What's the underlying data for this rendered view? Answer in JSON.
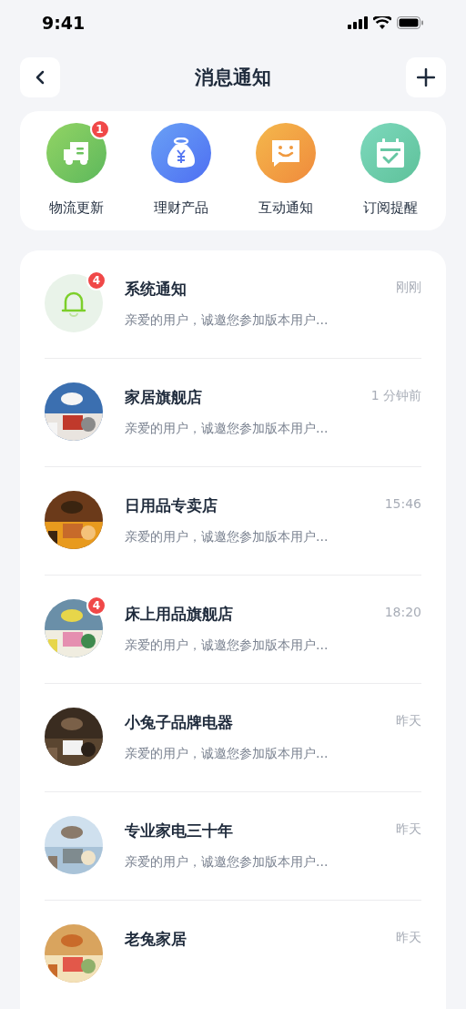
{
  "status_bar": {
    "time": "9:41"
  },
  "header": {
    "title": "消息通知"
  },
  "categories": [
    {
      "kind": "truck",
      "label": "物流更新",
      "badge": "1"
    },
    {
      "kind": "moneybag",
      "label": "理财产品"
    },
    {
      "kind": "chat",
      "label": "互动通知"
    },
    {
      "kind": "calendar",
      "label": "订阅提醒"
    }
  ],
  "messages": [
    {
      "kind": "bell",
      "badge": "4",
      "title": "系统通知",
      "time": "刚刚",
      "preview": "亲爱的用户，诚邀您参加版本用户..."
    },
    {
      "kind": "picture",
      "title": "家居旗舰店",
      "time": "1 分钟前",
      "preview": "亲爱的用户，诚邀您参加版本用户..."
    },
    {
      "kind": "picture",
      "title": "日用品专卖店",
      "time": "15:46",
      "preview": "亲爱的用户，诚邀您参加版本用户..."
    },
    {
      "kind": "picture",
      "badge": "4",
      "title": "床上用品旗舰店",
      "time": "18:20",
      "preview": "亲爱的用户，诚邀您参加版本用户..."
    },
    {
      "kind": "picture",
      "title": "小兔子品牌电器",
      "time": "昨天",
      "preview": "亲爱的用户，诚邀您参加版本用户..."
    },
    {
      "kind": "picture",
      "title": "专业家电三十年",
      "time": "昨天",
      "preview": "亲爱的用户，诚邀您参加版本用户..."
    },
    {
      "kind": "picture",
      "title": "老兔家居",
      "time": "昨天"
    }
  ]
}
